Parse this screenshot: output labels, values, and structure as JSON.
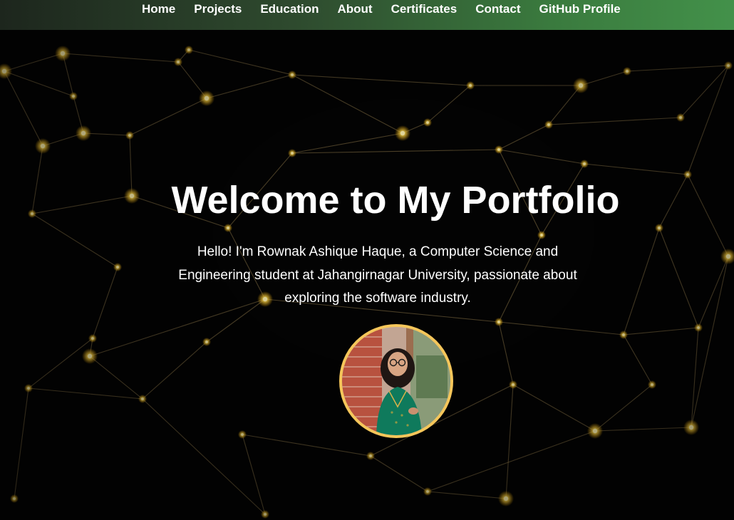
{
  "nav": {
    "items": [
      {
        "label": "Home"
      },
      {
        "label": "Projects"
      },
      {
        "label": "Education"
      },
      {
        "label": "About"
      },
      {
        "label": "Certificates"
      },
      {
        "label": "Contact"
      },
      {
        "label": "GitHub Profile"
      }
    ]
  },
  "hero": {
    "title": "Welcome to My Portfolio",
    "intro": "Hello! I'm Rownak Ashique Haque, a Computer Science and Engineering student at Jahangirnagar University, passionate about exploring the software industry."
  },
  "theme": {
    "nav_start": "#1d261d",
    "nav_end": "#43914a",
    "avatar_border": "#f5c65a",
    "glow": "#ffd24a"
  }
}
